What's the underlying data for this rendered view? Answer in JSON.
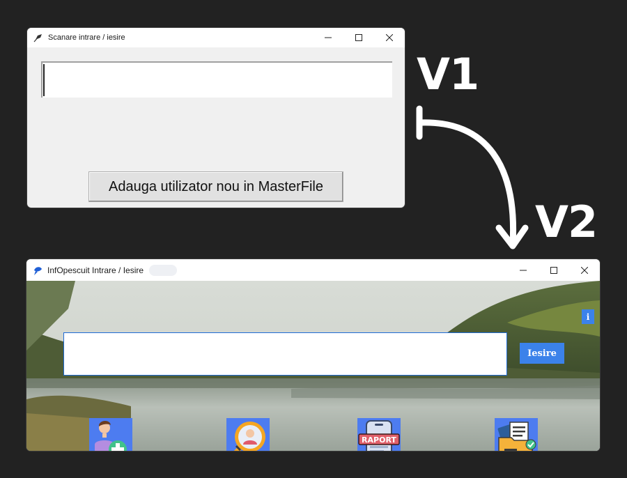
{
  "v1": {
    "window_title": "Scanare intrare / iesire",
    "entry_value": "",
    "add_user_button": "Adauga utilizator nou in MasterFile"
  },
  "labels": {
    "v1": "V1",
    "v2": "V2"
  },
  "v2": {
    "window_title": "InfOpescuit Intrare / Iesire",
    "entry_value": "",
    "exit_button": "Iesire",
    "info_button": "i",
    "raport_label": "RAPORT",
    "toolbar_icons": [
      "add-user-icon",
      "search-user-icon",
      "report-icon",
      "folder-docs-icon"
    ]
  },
  "colors": {
    "page_bg": "#222222",
    "accent_blue": "#3b82ea",
    "tile_blue": "#4d7cf0"
  }
}
